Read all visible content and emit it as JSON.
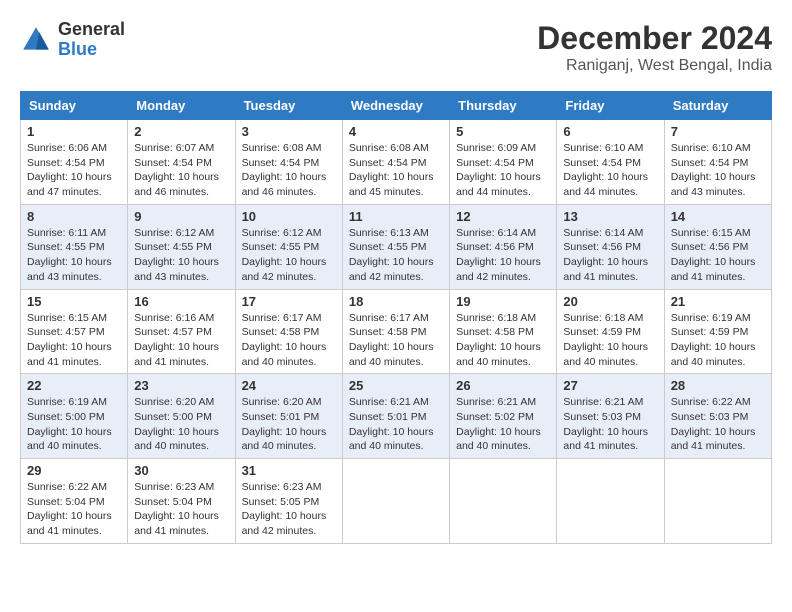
{
  "logo": {
    "general": "General",
    "blue": "Blue"
  },
  "title": {
    "month": "December 2024",
    "location": "Raniganj, West Bengal, India"
  },
  "calendar": {
    "headers": [
      "Sunday",
      "Monday",
      "Tuesday",
      "Wednesday",
      "Thursday",
      "Friday",
      "Saturday"
    ],
    "weeks": [
      [
        {
          "day": "1",
          "sunrise": "6:06 AM",
          "sunset": "4:54 PM",
          "daylight": "10 hours and 47 minutes."
        },
        {
          "day": "2",
          "sunrise": "6:07 AM",
          "sunset": "4:54 PM",
          "daylight": "10 hours and 46 minutes."
        },
        {
          "day": "3",
          "sunrise": "6:08 AM",
          "sunset": "4:54 PM",
          "daylight": "10 hours and 46 minutes."
        },
        {
          "day": "4",
          "sunrise": "6:08 AM",
          "sunset": "4:54 PM",
          "daylight": "10 hours and 45 minutes."
        },
        {
          "day": "5",
          "sunrise": "6:09 AM",
          "sunset": "4:54 PM",
          "daylight": "10 hours and 44 minutes."
        },
        {
          "day": "6",
          "sunrise": "6:10 AM",
          "sunset": "4:54 PM",
          "daylight": "10 hours and 44 minutes."
        },
        {
          "day": "7",
          "sunrise": "6:10 AM",
          "sunset": "4:54 PM",
          "daylight": "10 hours and 43 minutes."
        }
      ],
      [
        {
          "day": "8",
          "sunrise": "6:11 AM",
          "sunset": "4:55 PM",
          "daylight": "10 hours and 43 minutes."
        },
        {
          "day": "9",
          "sunrise": "6:12 AM",
          "sunset": "4:55 PM",
          "daylight": "10 hours and 43 minutes."
        },
        {
          "day": "10",
          "sunrise": "6:12 AM",
          "sunset": "4:55 PM",
          "daylight": "10 hours and 42 minutes."
        },
        {
          "day": "11",
          "sunrise": "6:13 AM",
          "sunset": "4:55 PM",
          "daylight": "10 hours and 42 minutes."
        },
        {
          "day": "12",
          "sunrise": "6:14 AM",
          "sunset": "4:56 PM",
          "daylight": "10 hours and 42 minutes."
        },
        {
          "day": "13",
          "sunrise": "6:14 AM",
          "sunset": "4:56 PM",
          "daylight": "10 hours and 41 minutes."
        },
        {
          "day": "14",
          "sunrise": "6:15 AM",
          "sunset": "4:56 PM",
          "daylight": "10 hours and 41 minutes."
        }
      ],
      [
        {
          "day": "15",
          "sunrise": "6:15 AM",
          "sunset": "4:57 PM",
          "daylight": "10 hours and 41 minutes."
        },
        {
          "day": "16",
          "sunrise": "6:16 AM",
          "sunset": "4:57 PM",
          "daylight": "10 hours and 41 minutes."
        },
        {
          "day": "17",
          "sunrise": "6:17 AM",
          "sunset": "4:58 PM",
          "daylight": "10 hours and 40 minutes."
        },
        {
          "day": "18",
          "sunrise": "6:17 AM",
          "sunset": "4:58 PM",
          "daylight": "10 hours and 40 minutes."
        },
        {
          "day": "19",
          "sunrise": "6:18 AM",
          "sunset": "4:58 PM",
          "daylight": "10 hours and 40 minutes."
        },
        {
          "day": "20",
          "sunrise": "6:18 AM",
          "sunset": "4:59 PM",
          "daylight": "10 hours and 40 minutes."
        },
        {
          "day": "21",
          "sunrise": "6:19 AM",
          "sunset": "4:59 PM",
          "daylight": "10 hours and 40 minutes."
        }
      ],
      [
        {
          "day": "22",
          "sunrise": "6:19 AM",
          "sunset": "5:00 PM",
          "daylight": "10 hours and 40 minutes."
        },
        {
          "day": "23",
          "sunrise": "6:20 AM",
          "sunset": "5:00 PM",
          "daylight": "10 hours and 40 minutes."
        },
        {
          "day": "24",
          "sunrise": "6:20 AM",
          "sunset": "5:01 PM",
          "daylight": "10 hours and 40 minutes."
        },
        {
          "day": "25",
          "sunrise": "6:21 AM",
          "sunset": "5:01 PM",
          "daylight": "10 hours and 40 minutes."
        },
        {
          "day": "26",
          "sunrise": "6:21 AM",
          "sunset": "5:02 PM",
          "daylight": "10 hours and 40 minutes."
        },
        {
          "day": "27",
          "sunrise": "6:21 AM",
          "sunset": "5:03 PM",
          "daylight": "10 hours and 41 minutes."
        },
        {
          "day": "28",
          "sunrise": "6:22 AM",
          "sunset": "5:03 PM",
          "daylight": "10 hours and 41 minutes."
        }
      ],
      [
        {
          "day": "29",
          "sunrise": "6:22 AM",
          "sunset": "5:04 PM",
          "daylight": "10 hours and 41 minutes."
        },
        {
          "day": "30",
          "sunrise": "6:23 AM",
          "sunset": "5:04 PM",
          "daylight": "10 hours and 41 minutes."
        },
        {
          "day": "31",
          "sunrise": "6:23 AM",
          "sunset": "5:05 PM",
          "daylight": "10 hours and 42 minutes."
        },
        null,
        null,
        null,
        null
      ]
    ]
  }
}
